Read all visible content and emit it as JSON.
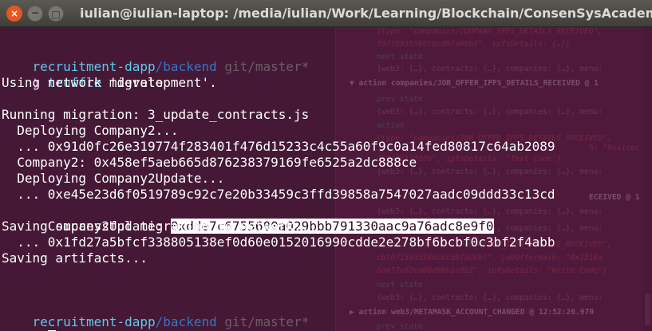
{
  "window": {
    "title": "iulian@iulian-laptop: /media/iulian/Work/Learning/Blockchain/ConsenSysAcademy/Fin",
    "close_glyph": "×",
    "minimize_glyph": "−",
    "maximize_glyph": "□"
  },
  "devtools": {
    "lines": [
      {
        "text": "{type: \"companies/COMPANY_IPFS_DETAILS_RECEIVED\",",
        "cls": "dt-red"
      },
      {
        "text": "f0715935566cbcd0fa06b7\", ipfsDetails: {…}}",
        "cls": "dt-red"
      },
      {
        "text": "next state",
        "cls": "dt-green"
      },
      {
        "text": "{web3: {…}, contracts: {…}, companies: {…}, menu:",
        "cls": "dt-muted"
      },
      {
        "text": "▼ action companies/JOB_OFFER_IPFS_DETAILS_RECEIVED @ 1",
        "cls": "dt-bold"
      },
      {
        "text": "prev state",
        "cls": "dt-green"
      },
      {
        "text": "{web3: {…}, contracts: {…}, companies: {…}, menu:",
        "cls": "dt-muted"
      },
      {
        "text": "action",
        "cls": "dt-green"
      },
      {
        "text": "{type: \"companies/JOB_OFFER_IPFS_DETAILS_RECEIVED\",",
        "cls": "dt-red"
      },
      {
        "text": "h: \"0xa1eec",
        "cls": "dt-red"
      },
      {
        "text": "d2143612f88b\", ipfsDetails: \"Test Code\"}",
        "cls": "dt-red"
      },
      {
        "text": "{web3: {…}, contracts: {…}, companies: {…}, menu:",
        "cls": "dt-muted"
      },
      {
        "text": "ECEIVED @ 1",
        "cls": "dt-bold"
      },
      {
        "text": "{web3: {…}, contracts: {…}, companies: {…}, menu:",
        "cls": "dt-muted"
      },
      {
        "text": "{web3: {…}, contracts: {…}, companies: {…}, menu:",
        "cls": "dt-muted"
      },
      {
        "text": "{type: \"companies/JOB_OFFER_IPFS_DETAILS_RECEIVED\",",
        "cls": "dt-red"
      },
      {
        "text": "cbf0715935566cbcd0fa06b7\", jobOfferHash: \"0x1216a",
        "cls": "dt-red"
      },
      {
        "text": "6d457e62ed06d98b1c8b2\", ipfsDetails: \"Write Code\"}",
        "cls": "dt-red"
      },
      {
        "text": "next state",
        "cls": "dt-green"
      },
      {
        "text": "{web3: {…}, contracts: {…}, companies: {…}, menu:",
        "cls": "dt-muted"
      },
      {
        "text": "▶ action web3/METAMASK_ACCOUNT_CHANGED @ 12:52:26.970",
        "cls": "dt-bold"
      },
      {
        "text": "prev state",
        "cls": "dt-green"
      }
    ]
  },
  "terminal": {
    "prompt1": {
      "dir": "recruitment-dapp",
      "slash": "/",
      "subdir": "backend",
      "git": " git/master*"
    },
    "command": {
      "chevron": "❯ ",
      "cmd": "truffle",
      "args": " migrate"
    },
    "output": [
      "Using network 'development'.",
      "",
      "Running migration: 3_update_contracts.js",
      "  Deploying Company2...",
      "  ... 0x91d0fc26e319774f283401f476d15233c4c55a60f9c0a14fed80817c64ab2089",
      "  Company2: 0x458ef5aeb665d876238379169fe6525a2dc888ce",
      "  Deploying Company2Update...",
      "  ... 0xe45e23d6f0519789c92c7e20b33459c3ffd39858a7547027aadc09ddd33c13cd"
    ],
    "company2update_label": "  Company2Update: ",
    "company2update_address": "0xdde7c6755600a029bbb791330aac9a76adc8e9f0",
    "output2": [
      "Saving successful migration to network...",
      "  ... 0x1fd27a5bfcf338805138ef0d60e0152016990cdde2e278bf6bcbf0c3bf2f4abb",
      "Saving artifacts..."
    ],
    "prompt2": {
      "dir": "recruitment-dapp",
      "slash": "/",
      "subdir": "backend",
      "git": " git/master*"
    },
    "prompt_chevron": "❯ "
  }
}
